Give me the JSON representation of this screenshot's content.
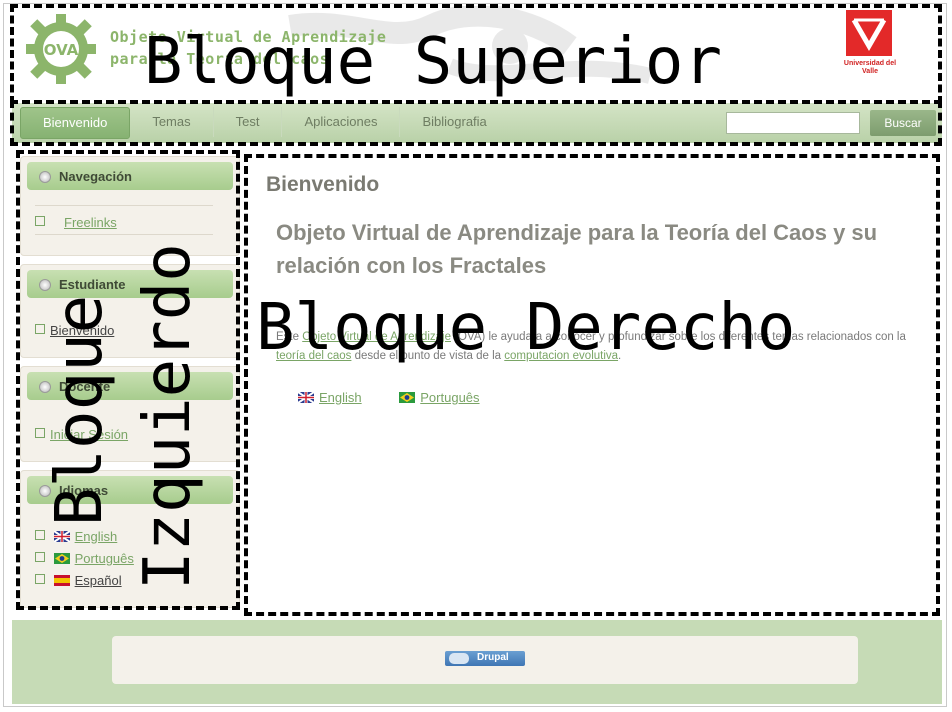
{
  "header": {
    "site_name_line1": "Objeto Virtual de Aprendizaje",
    "site_name_line2": "para la Teoría del caos",
    "logo_text": "OVA",
    "university": "Universidad del Valle"
  },
  "nav": {
    "tabs": [
      {
        "label": "Bienvenido",
        "active": true
      },
      {
        "label": "Temas"
      },
      {
        "label": "Test"
      },
      {
        "label": "Aplicaciones"
      },
      {
        "label": "Bibliografia"
      }
    ],
    "search_button": "Buscar",
    "search_value": ""
  },
  "sidebar": {
    "navegacion": {
      "title": "Navegación",
      "links": [
        "Freelinks"
      ]
    },
    "estudiante": {
      "title": "Estudiante",
      "links": [
        "Bienvenido"
      ]
    },
    "docente": {
      "title": "Docente",
      "links": [
        "Iniciar Sesión"
      ]
    },
    "idiomas": {
      "title": "Idiomas",
      "links": [
        "English",
        "Português",
        "Español"
      ]
    }
  },
  "main": {
    "page_title": "Bienvenido",
    "heading": "Objeto Virtual de Aprendizaje para la Teoría del Caos y su relación con los Fractales",
    "body_pre": "Este ",
    "body_link1": "Objeto Virtual de Aprendizaje",
    "body_mid1": " (OVA) le ayudara a conocer y profundizar sobre los diferentes temas relacionados con la ",
    "body_link2": "teoría del caos",
    "body_mid2": " desde el punto de vista de la ",
    "body_link3": "computacion evolutiva",
    "body_end": ".",
    "languages": [
      "English",
      "Português"
    ]
  },
  "footer": {
    "badge": "Drupal"
  },
  "overlay": {
    "top_label": "Bloque Superior",
    "left_label_line1": "Bloque",
    "left_label_line2": "Izquierdo",
    "right_label": "Bloque Derecho"
  },
  "colors": {
    "accent_green": "#7aa566",
    "nav_bg": "#c6dbb6",
    "univalle_red": "#e32929"
  }
}
